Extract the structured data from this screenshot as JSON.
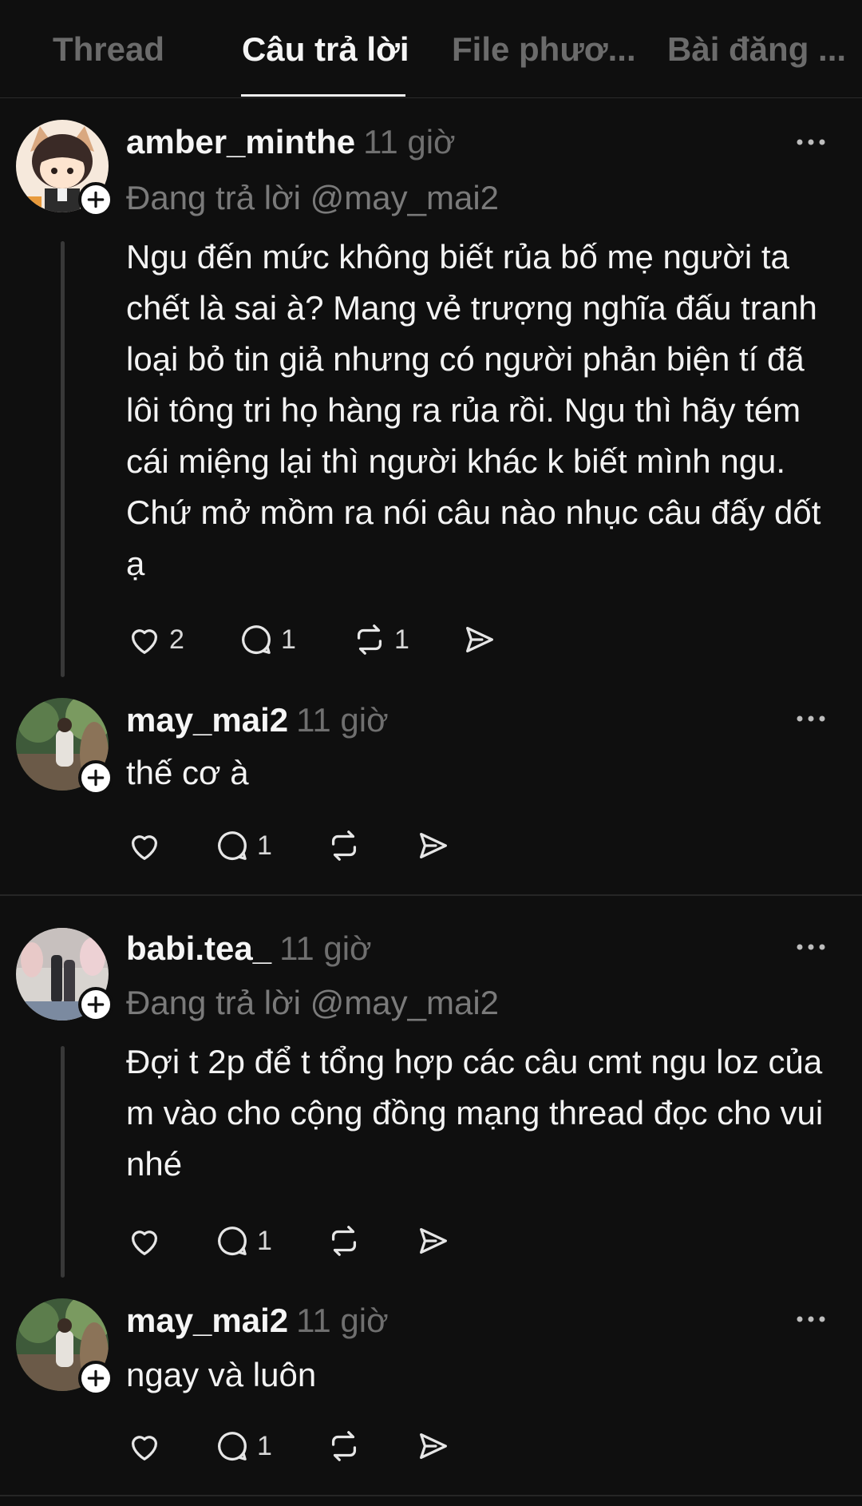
{
  "tabs": [
    {
      "label": "Thread"
    },
    {
      "label": "Câu trả lời"
    },
    {
      "label": "File phươ..."
    },
    {
      "label": "Bài đăng ..."
    }
  ],
  "posts": [
    {
      "username": "amber_minthe",
      "time": "11 giờ",
      "reply_to": "Đang trả lời @may_mai2",
      "text": "Ngu đến mức không biết rủa bố mẹ người ta chết là sai à? Mang vẻ trượng nghĩa đấu tranh loại bỏ tin giả nhưng có người phản biện tí đã lôi tông tri họ hàng ra rủa rồi. Ngu thì hãy tém cái miệng lại thì người khác k biết mình ngu. Chứ mở mồm ra nói câu nào nhục câu đấy dốt ạ",
      "likes": "2",
      "comments": "1",
      "reposts": "1"
    },
    {
      "username": "may_mai2",
      "time": "11 giờ",
      "text": "thế cơ à",
      "comments": "1"
    },
    {
      "username": "babi.tea_",
      "time": "11 giờ",
      "reply_to": "Đang trả lời @may_mai2",
      "text": "Đợi t 2p để t tổng hợp các câu cmt ngu loz của m vào cho cộng đồng mạng thread đọc cho vui nhé",
      "comments": "1"
    },
    {
      "username": "may_mai2",
      "time": "11 giờ",
      "text": "ngay và luôn",
      "comments": "1"
    }
  ],
  "colors": {
    "background": "#0f0f0f",
    "text": "#f3f3f3",
    "muted": "#6f6f6f",
    "divider": "#262626"
  }
}
